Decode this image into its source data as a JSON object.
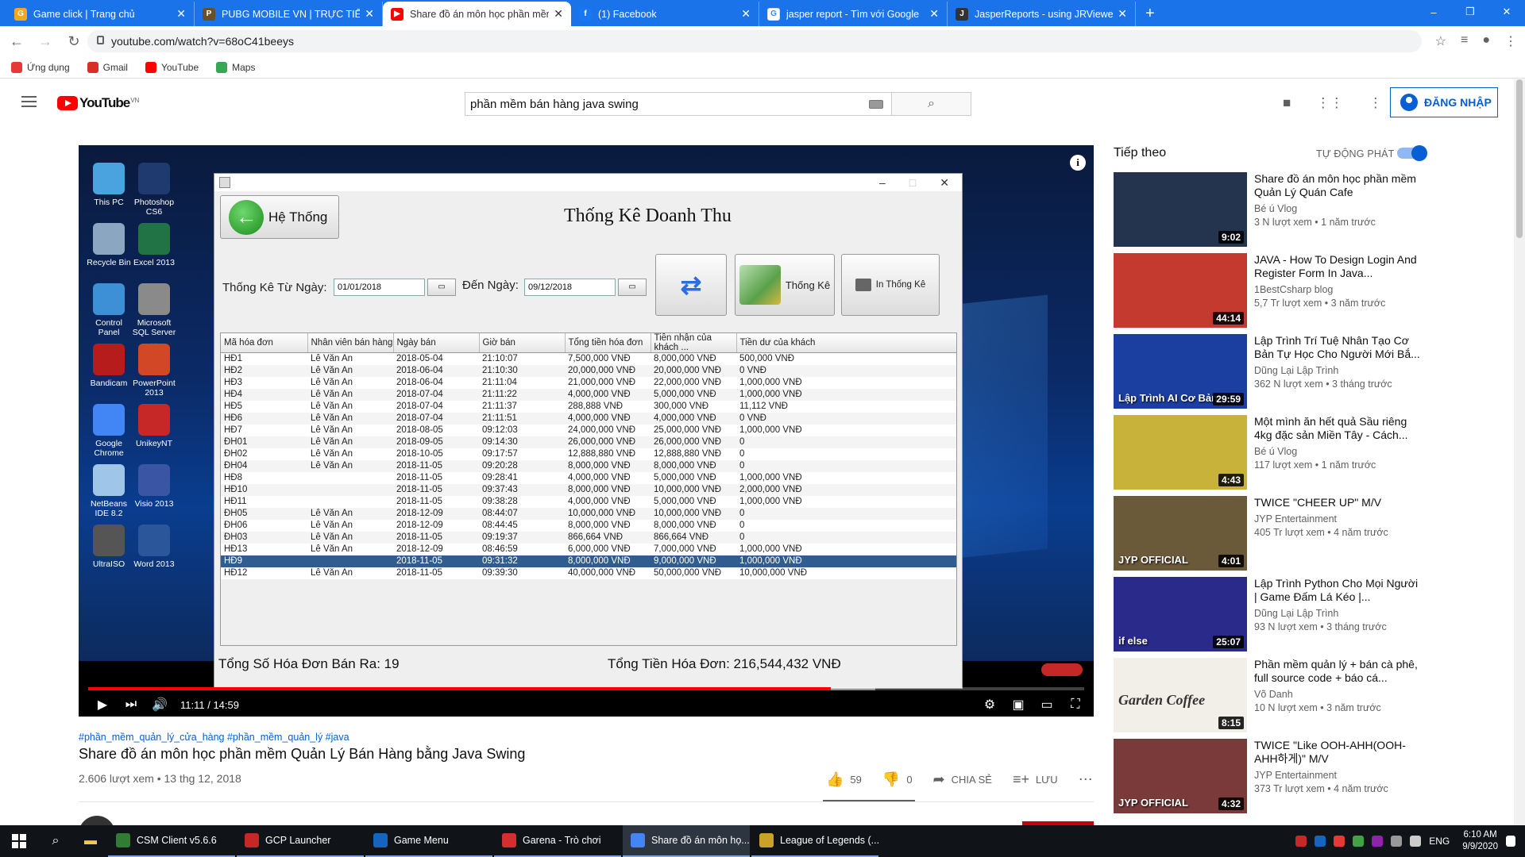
{
  "browser": {
    "tabs": [
      {
        "title": "Game click | Trang chủ",
        "color": "#f5a623",
        "glyph": "G",
        "active": false
      },
      {
        "title": "PUBG MOBILE VN | TRỰC TIẾP GI",
        "color": "#6b4f2a",
        "glyph": "P",
        "active": false
      },
      {
        "title": "Share đồ án môn học phần mềm",
        "color": "#ff0000",
        "glyph": "▶",
        "active": true
      },
      {
        "title": "(1) Facebook",
        "color": "#1877f2",
        "glyph": "f",
        "active": false
      },
      {
        "title": "jasper report - Tìm với Google",
        "color": "#ffffff",
        "glyph": "G",
        "active": false
      },
      {
        "title": "JasperReports - using JRViewer t",
        "color": "#333333",
        "glyph": "J",
        "active": false
      }
    ],
    "url": "youtube.com/watch?v=68oC41beeys",
    "bookmarks": [
      {
        "label": "Ứng dụng",
        "color": "#e53935"
      },
      {
        "label": "Gmail",
        "color": "#d93025"
      },
      {
        "label": "YouTube",
        "color": "#ff0000"
      },
      {
        "label": "Maps",
        "color": "#34a853"
      }
    ]
  },
  "youtube": {
    "logo_text": "YouTube",
    "region": "VN",
    "search_query": "phần mềm bán hàng java swing",
    "sign_in": "ĐĂNG NHẬP"
  },
  "video_app": {
    "back_label": "Hệ Thống",
    "heading": "Thống Kê Doanh Thu",
    "from_label": "Thống Kê Từ Ngày:",
    "from_date": "01/01/2018",
    "to_label": "Đến Ngày:",
    "to_date": "09/12/2018",
    "stats_button": "Thống Kê",
    "print_button": "In Thống Kê",
    "columns": [
      "Mã hóa đơn",
      "Nhân viên bán hàng",
      "Ngày bán",
      "Giờ bán",
      "Tổng tiền hóa đơn",
      "Tiền nhận của khách ...",
      "Tiền dư của khách"
    ],
    "rows": [
      [
        "HĐ1",
        "Lê Văn An",
        "2018-05-04",
        "21:10:07",
        "7,500,000 VNĐ",
        "8,000,000 VNĐ",
        "500,000 VNĐ"
      ],
      [
        "HĐ2",
        "Lê Văn An",
        "2018-06-04",
        "21:10:30",
        "20,000,000 VNĐ",
        "20,000,000 VNĐ",
        "0 VNĐ"
      ],
      [
        "HĐ3",
        "Lê Văn An",
        "2018-06-04",
        "21:11:04",
        "21,000,000 VNĐ",
        "22,000,000 VNĐ",
        "1,000,000 VNĐ"
      ],
      [
        "HĐ4",
        "Lê Văn An",
        "2018-07-04",
        "21:11:22",
        "4,000,000 VNĐ",
        "5,000,000 VNĐ",
        "1,000,000 VNĐ"
      ],
      [
        "HĐ5",
        "Lê Văn An",
        "2018-07-04",
        "21:11:37",
        "288,888 VNĐ",
        "300,000 VNĐ",
        "11,112 VNĐ"
      ],
      [
        "HĐ6",
        "Lê Văn An",
        "2018-07-04",
        "21:11:51",
        "4,000,000 VNĐ",
        "4,000,000 VNĐ",
        "0 VNĐ"
      ],
      [
        "HĐ7",
        "Lê Văn An",
        "2018-08-05",
        "09:12:03",
        "24,000,000 VNĐ",
        "25,000,000 VNĐ",
        "1,000,000 VNĐ"
      ],
      [
        "ĐH01",
        "Lê Văn An",
        "2018-09-05",
        "09:14:30",
        "26,000,000 VNĐ",
        "26,000,000 VNĐ",
        "0"
      ],
      [
        "ĐH02",
        "Lê Văn An",
        "2018-10-05",
        "09:17:57",
        "12,888,880 VNĐ",
        "12,888,880 VNĐ",
        "0"
      ],
      [
        "ĐH04",
        "Lê Văn An",
        "2018-11-05",
        "09:20:28",
        "8,000,000 VNĐ",
        "8,000,000 VNĐ",
        "0"
      ],
      [
        "HĐ8",
        "",
        "2018-11-05",
        "09:28:41",
        "4,000,000 VNĐ",
        "5,000,000 VNĐ",
        "1,000,000 VNĐ"
      ],
      [
        "HĐ10",
        "",
        "2018-11-05",
        "09:37:43",
        "8,000,000 VNĐ",
        "10,000,000 VNĐ",
        "2,000,000 VNĐ"
      ],
      [
        "HĐ11",
        "",
        "2018-11-05",
        "09:38:28",
        "4,000,000 VNĐ",
        "5,000,000 VNĐ",
        "1,000,000 VNĐ"
      ],
      [
        "ĐH05",
        "Lê Văn An",
        "2018-12-09",
        "08:44:07",
        "10,000,000 VNĐ",
        "10,000,000 VNĐ",
        "0"
      ],
      [
        "ĐH06",
        "Lê Văn An",
        "2018-12-09",
        "08:44:45",
        "8,000,000 VNĐ",
        "8,000,000 VNĐ",
        "0"
      ],
      [
        "ĐH03",
        "Lê Văn An",
        "2018-11-05",
        "09:19:37",
        "866,664 VNĐ",
        "866,664 VNĐ",
        "0"
      ],
      [
        "HĐ13",
        "Lê Văn An",
        "2018-12-09",
        "08:46:59",
        "6,000,000 VNĐ",
        "7,000,000 VNĐ",
        "1,000,000 VNĐ"
      ],
      [
        "HĐ9",
        "",
        "2018-11-05",
        "09:31:32",
        "8,000,000 VNĐ",
        "9,000,000 VNĐ",
        "1,000,000 VNĐ"
      ],
      [
        "HĐ12",
        "Lê Văn An",
        "2018-11-05",
        "09:39:30",
        "40,000,000 VNĐ",
        "50,000,000 VNĐ",
        "10,000,000 VNĐ"
      ]
    ],
    "selected_row": 17,
    "total_count_label": "Tổng Số Hóa Đơn Bán Ra: 19",
    "total_amount_label": "Tổng Tiền Hóa Đơn: 216,544,432 VNĐ"
  },
  "desktop_icons": [
    {
      "label": "This PC",
      "color": "#4aa3df"
    },
    {
      "label": "Photoshop CS6",
      "color": "#1f3a6e"
    },
    {
      "label": "Recycle Bin",
      "color": "#8aa6c1"
    },
    {
      "label": "Excel 2013",
      "color": "#217346"
    },
    {
      "label": "Control Panel",
      "color": "#3d8fd6"
    },
    {
      "label": "Microsoft SQL Server ...",
      "color": "#8a8a8a"
    },
    {
      "label": "Bandicam",
      "color": "#b71c1c"
    },
    {
      "label": "PowerPoint 2013",
      "color": "#d24726"
    },
    {
      "label": "Google Chrome",
      "color": "#4285f4"
    },
    {
      "label": "UnikeyNT",
      "color": "#c62828"
    },
    {
      "label": "NetBeans IDE 8.2",
      "color": "#9fc5e8"
    },
    {
      "label": "Visio 2013",
      "color": "#3955a3"
    },
    {
      "label": "UltraISO",
      "color": "#555555"
    },
    {
      "label": "Word 2013",
      "color": "#2b579a"
    }
  ],
  "player": {
    "current_time": "11:11",
    "duration": "14:59",
    "played_fraction": 0.746,
    "buffered_fraction": 0.79
  },
  "video": {
    "hashtags": "#phần_mềm_quản_lý_cửa_hàng #phần_mềm_quản_lý #java",
    "title": "Share đồ án môn học phần mềm Quản Lý Bán Hàng bằng Java Swing",
    "meta": "2.606 lượt xem • 13 thg 12, 2018",
    "likes": "59",
    "dislikes": "0",
    "share": "CHIA SẺ",
    "save": "LƯU"
  },
  "sidebar": {
    "up_next": "Tiếp theo",
    "autoplay": "TỰ ĐỘNG PHÁT",
    "items": [
      {
        "title": "Share đồ án môn học phần mềm Quản Lý Quán Cafe",
        "channel": "Bé ú Vlog",
        "views": "3 N lượt xem • 1 năm trước",
        "duration": "9:02",
        "thumb": "#24344f",
        "overlay": ""
      },
      {
        "title": "JAVA - How To Design Login And Register Form In Java...",
        "channel": "1BestCsharp blog",
        "views": "5,7 Tr lượt xem • 3 năm trước",
        "duration": "44:14",
        "thumb": "#c43a2f",
        "overlay": ""
      },
      {
        "title": "Lập Trình Trí Tuệ Nhân Tạo Cơ Bản Tự Học Cho Người Mới Bắ...",
        "channel": "Dũng Lại Lập Trình",
        "views": "362 N lượt xem • 3 tháng trước",
        "duration": "29:59",
        "thumb": "#1b3fa0",
        "overlay": "Lập Trình AI Cơ Bản"
      },
      {
        "title": "Một mình ăn hết quả Sầu riêng 4kg đặc sản Miền Tây - Cách...",
        "channel": "Bé ú Vlog",
        "views": "117 lượt xem • 1 năm trước",
        "duration": "4:43",
        "thumb": "#c9b23a",
        "overlay": ""
      },
      {
        "title": "TWICE \"CHEER UP\" M/V",
        "channel": "JYP Entertainment",
        "views": "405 Tr lượt xem • 4 năm trước",
        "duration": "4:01",
        "thumb": "#6b5a3a",
        "overlay": "JYP OFFICIAL"
      },
      {
        "title": "Lập Trình Python Cho Mọi Người | Game Đấm Lá Kéo |...",
        "channel": "Dũng Lại Lập Trình",
        "views": "93 N lượt xem • 3 tháng trước",
        "duration": "25:07",
        "thumb": "#2a2a8a",
        "overlay": "if else"
      },
      {
        "title": "Phần mềm quản lý + bán cà phê, full source code + báo cá...",
        "channel": "Võ Danh",
        "views": "10 N lượt xem • 3 năm trước",
        "duration": "8:15",
        "thumb": "#f2efe8",
        "overlay": "Garden Coffee"
      },
      {
        "title": "TWICE \"Like OOH-AHH(OOH-AHH하게)\" M/V",
        "channel": "JYP Entertainment",
        "views": "373 Tr lượt xem • 4 năm trước",
        "duration": "4:32",
        "thumb": "#7a3a3a",
        "overlay": "JYP OFFICIAL"
      }
    ]
  },
  "taskbar": {
    "apps": [
      {
        "label": "CSM Client v5.6.6",
        "color": "#2e7d32",
        "active": false
      },
      {
        "label": "GCP Launcher",
        "color": "#c62828",
        "active": false
      },
      {
        "label": "Game Menu",
        "color": "#1565c0",
        "active": false
      },
      {
        "label": "Garena - Trò chơi",
        "color": "#d32f2f",
        "active": false
      },
      {
        "label": "Share đồ án môn họ...",
        "color": "#4285f4",
        "active": true
      },
      {
        "label": "League of Legends (...",
        "color": "#c9a227",
        "active": false
      }
    ],
    "lang": "ENG",
    "time": "6:10 AM",
    "date": "9/9/2020"
  }
}
